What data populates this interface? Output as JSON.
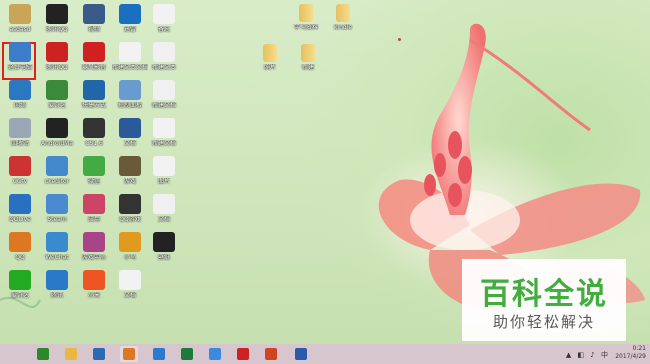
{
  "desktop": {
    "icons": [
      {
        "label": "asdasd",
        "name": "desktop-icon-1",
        "color": "#c9a55a"
      },
      {
        "label": "腾讯QQ",
        "name": "desktop-icon-2",
        "color": "#222222"
      },
      {
        "label": "视频",
        "name": "desktop-icon-3",
        "color": "#3a5a8a"
      },
      {
        "label": "迅雷",
        "name": "desktop-icon-4",
        "color": "#1a6fc0"
      },
      {
        "label": "备忘",
        "name": "desktop-icon-5",
        "color": "#f2f2f2"
      },
      {
        "label": "这台电脑",
        "name": "this-pc-icon",
        "color": "#3b7dc8"
      },
      {
        "label": "腾讯QQ",
        "name": "desktop-icon-7",
        "color": "#cc2222"
      },
      {
        "label": "暴风影音",
        "name": "desktop-icon-8",
        "color": "#d02020"
      },
      {
        "label": "新建文本文档",
        "name": "desktop-icon-9",
        "color": "#f2f2f2"
      },
      {
        "label": "新建文本",
        "name": "desktop-icon-10",
        "color": "#f0f0f0"
      },
      {
        "label": "网络",
        "name": "desktop-icon-11",
        "color": "#2a78c0"
      },
      {
        "label": "爱奇艺",
        "name": "desktop-icon-12",
        "color": "#3a8a3a"
      },
      {
        "label": "快捷方式",
        "name": "desktop-icon-13",
        "color": "#2266aa"
      },
      {
        "label": "控制面板",
        "name": "desktop-icon-14",
        "color": "#6a9bd0"
      },
      {
        "label": "新建文档",
        "name": "desktop-icon-15",
        "color": "#f0f0f0"
      },
      {
        "label": "回收站",
        "name": "desktop-icon-16",
        "color": "#9aa7b5"
      },
      {
        "label": "AndroidMa",
        "name": "desktop-icon-17",
        "color": "#222222"
      },
      {
        "label": "CS1.6",
        "name": "desktop-icon-18",
        "color": "#333333"
      },
      {
        "label": "文档",
        "name": "desktop-icon-19",
        "color": "#2a5a9a"
      },
      {
        "label": "新建文档",
        "name": "desktop-icon-20",
        "color": "#f2f2f2"
      },
      {
        "label": "CCtv",
        "name": "desktop-icon-21",
        "color": "#cc3333"
      },
      {
        "label": "ckeditor",
        "name": "desktop-icon-22",
        "color": "#4488cc"
      },
      {
        "label": "微信",
        "name": "desktop-icon-23",
        "color": "#44aa44"
      },
      {
        "label": "游戏",
        "name": "desktop-icon-24",
        "color": "#6a5a3a"
      },
      {
        "label": "图片",
        "name": "desktop-icon-25",
        "color": "#f2f2f2"
      },
      {
        "label": "QQLive",
        "name": "desktop-icon-26",
        "color": "#2a70c0"
      },
      {
        "label": "Steam",
        "name": "desktop-icon-27",
        "color": "#4a8ad0"
      },
      {
        "label": "应用",
        "name": "desktop-icon-28",
        "color": "#cc4466"
      },
      {
        "label": "QQ游戏",
        "name": "desktop-icon-29",
        "color": "#333333"
      },
      {
        "label": "文档",
        "name": "desktop-icon-30",
        "color": "#f0f0f0"
      },
      {
        "label": "QQ",
        "name": "desktop-icon-31",
        "color": "#dd7722"
      },
      {
        "label": "WeChat",
        "name": "desktop-icon-32",
        "color": "#3a8ad0"
      },
      {
        "label": "游戏中心",
        "name": "desktop-icon-33",
        "color": "#aa4488"
      },
      {
        "label": "小鸟",
        "name": "desktop-icon-34",
        "color": "#e09a20"
      },
      {
        "label": "壁纸",
        "name": "desktop-icon-35",
        "color": "#222222"
      },
      {
        "label": "爱奇艺",
        "name": "desktop-icon-36",
        "color": "#22aa22"
      },
      {
        "label": "腾讯",
        "name": "desktop-icon-37",
        "color": "#2a78c8"
      },
      {
        "label": "小米",
        "name": "desktop-icon-38",
        "color": "#ee5522"
      },
      {
        "label": "文档",
        "name": "desktop-icon-39",
        "color": "#f2f2f2"
      }
    ],
    "folders": [
      {
        "label": "学习资料",
        "name": "folder-1"
      },
      {
        "label": "kindle",
        "name": "folder-2"
      },
      {
        "label": "照片",
        "name": "folder-3"
      },
      {
        "label": "新建",
        "name": "folder-4"
      }
    ]
  },
  "watermark": {
    "title": "百科全说",
    "subtitle": "助你轻松解决"
  },
  "taskbar": {
    "apps": [
      {
        "name": "start-icon",
        "color": "#2a8a2a"
      },
      {
        "name": "file-explorer-icon",
        "color": "#e8b840"
      },
      {
        "name": "k-app-icon",
        "color": "#2a6ab0"
      },
      {
        "name": "browser-icon",
        "color": "#dd7722"
      },
      {
        "name": "sogou-icon",
        "color": "#2a7ad0"
      },
      {
        "name": "excel-icon",
        "color": "#1e7a3a"
      },
      {
        "name": "baidu-netdisk-icon",
        "color": "#3a8ae0"
      },
      {
        "name": "pdf-icon",
        "color": "#cc2222"
      },
      {
        "name": "powerpoint-icon",
        "color": "#d04422"
      },
      {
        "name": "word-icon",
        "color": "#2a5aa8"
      }
    ],
    "clock": {
      "time": "0:21",
      "date": "2017/4/29"
    }
  }
}
